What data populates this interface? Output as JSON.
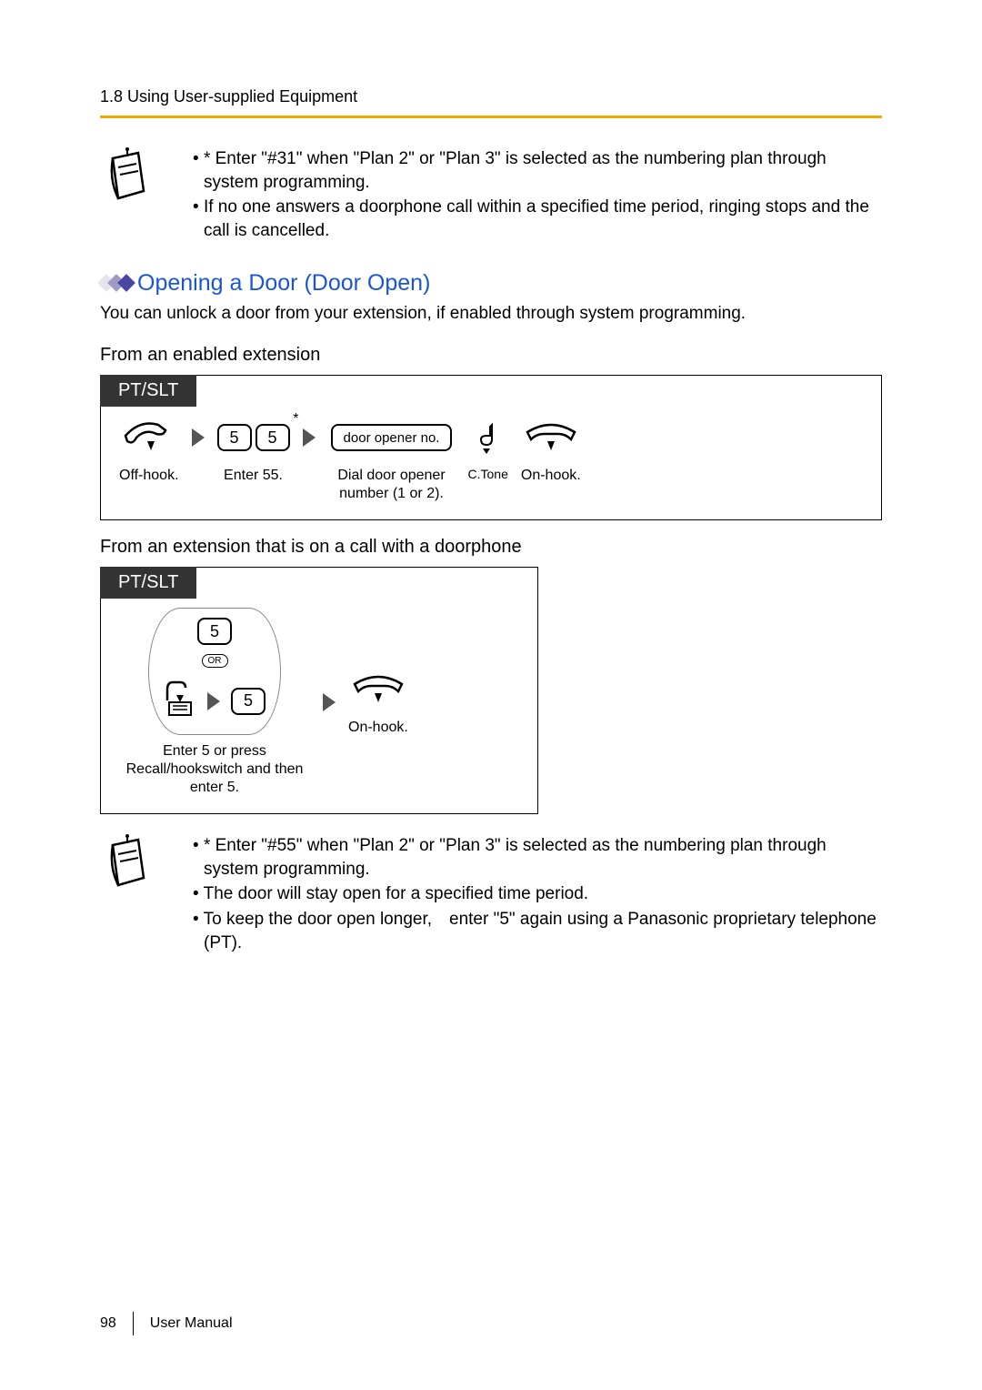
{
  "header": {
    "crumb": "1.8 Using User-supplied Equipment"
  },
  "note_top": {
    "bullet1": "* Enter \"#31\" when \"Plan 2\" or \"Plan 3\" is selected as the numbering plan through system programming.",
    "bullet2": "If no one answers a doorphone call within a specified time period, ringing stops and the call is cancelled."
  },
  "section": {
    "title": "Opening a Door (Door Open)",
    "intro": "You can unlock a door from your extension, if enabled through system programming."
  },
  "proc1": {
    "subhead": "From an enabled extension",
    "tab": "PT/SLT",
    "step1_label": "Off-hook.",
    "step2_key1": "5",
    "step2_key2": "5",
    "step2_label": "Enter 55.",
    "step3_key": "door opener no.",
    "step3_label": "Dial door opener number  (1 or 2).",
    "step4_label": "C.Tone",
    "step5_label": "On-hook."
  },
  "proc2": {
    "subhead": "From an extension that is on a call with a doorphone",
    "tab": "PT/SLT",
    "opt_key": "5",
    "opt_or": "OR",
    "opt_key2": "5",
    "step1_label": "Enter 5 or press Recall/hookswitch and then enter 5.",
    "step2_label": "On-hook."
  },
  "note_bottom": {
    "bullet1": "* Enter \"#55\" when \"Plan 2\" or \"Plan 3\" is selected as the numbering plan through system programming.",
    "bullet2": "The door will stay open for a specified time period.",
    "bullet3": "To keep the door open longer, enter \"5\" again using a Panasonic proprietary telephone (PT)."
  },
  "footer": {
    "page": "98",
    "doc": "User Manual"
  }
}
